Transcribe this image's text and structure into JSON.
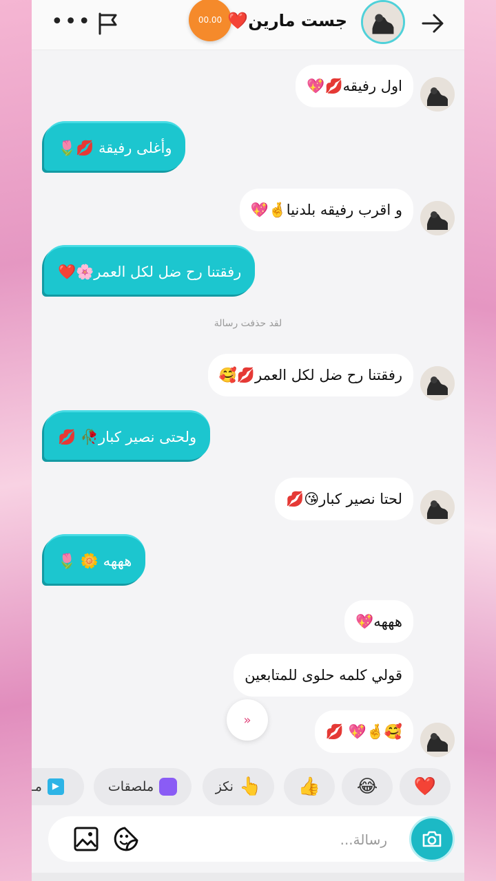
{
  "header": {
    "more_icon": "more-icon",
    "flag_icon": "flag-icon",
    "timer": "00.00",
    "contact_name": "جست مارين❤️",
    "back_icon": "arrow-right-icon"
  },
  "messages": [
    {
      "side": "in",
      "text": "اول رفيقه💋💖"
    },
    {
      "side": "out",
      "text": "وأغلى رفيقة 💋🌷"
    },
    {
      "side": "in",
      "text": "و اقرب رفيقه بلدنيا🤞💖"
    },
    {
      "side": "out",
      "text": "رفقتنا رح ضل لكل العمر🌸❤️"
    },
    {
      "side": "in",
      "text": "رفقتنا رح ضل لكل العمر💋🥰"
    },
    {
      "side": "out",
      "text": "ولحتى نصير كبار🥀 💋"
    },
    {
      "side": "in",
      "text": "لحتا نصير كبار😘💋"
    },
    {
      "side": "out",
      "text": "هههه 🌼 🌷"
    },
    {
      "side": "in",
      "text": "هههه💖"
    },
    {
      "side": "in",
      "text": "قولي كلمه حلوى للمتابعين"
    },
    {
      "side": "in",
      "text": "🥰🤞💖 💋"
    }
  ],
  "system_notice": "لقد حذفت رسالة",
  "quick_reactions": [
    {
      "emoji": "❤️",
      "label": ""
    },
    {
      "emoji": "😂",
      "label": ""
    },
    {
      "emoji": "👍",
      "label": ""
    },
    {
      "emoji": "👆",
      "label": "نكز"
    },
    {
      "emoji": "🟪",
      "label": "ملصقات"
    },
    {
      "emoji": "▶️",
      "label": "مـ"
    }
  ],
  "input": {
    "placeholder": "رسالة...",
    "image_icon": "image-icon",
    "sticker_icon": "sticker-icon",
    "camera_icon": "camera-icon"
  },
  "colors": {
    "outgoing_bubble": "#1cc6cf",
    "timer": "#f58a2b",
    "camera": "#1cb9c5"
  }
}
